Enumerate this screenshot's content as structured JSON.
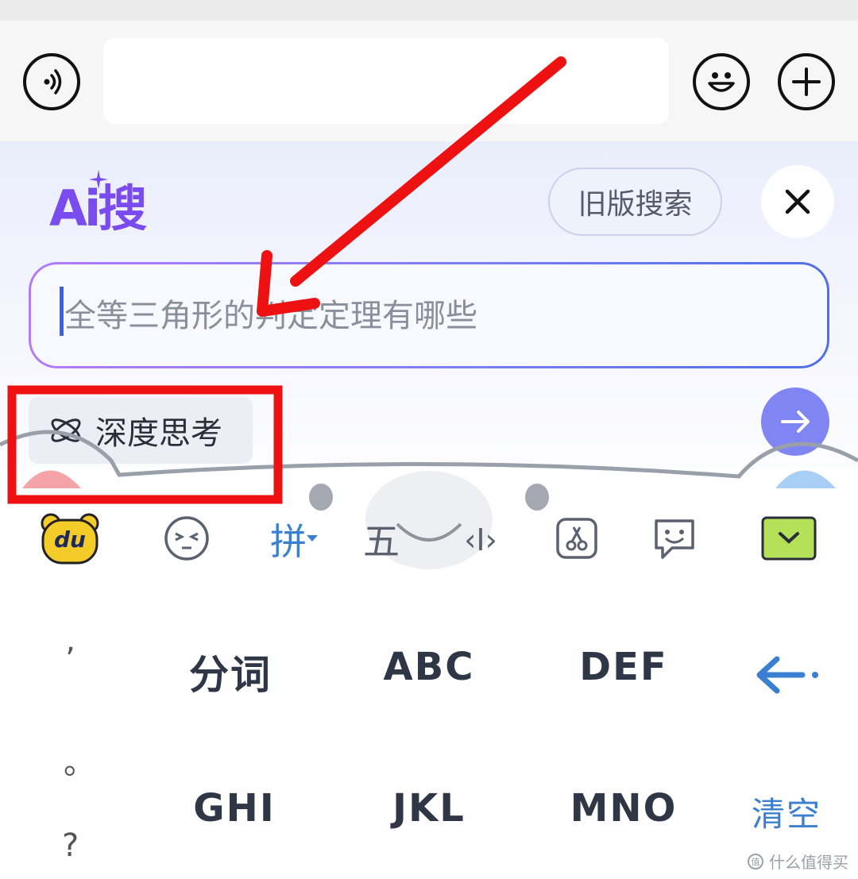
{
  "chat_bar": {
    "voice_icon": "voice-icon",
    "emoji_icon": "emoji-icon",
    "plus_icon": "plus-icon"
  },
  "ai_search": {
    "logo_text": "Ai搜",
    "old_search_label": "旧版搜索",
    "close_icon": "close-icon",
    "input_placeholder": "全等三角形的判定定理有哪些",
    "deep_think_label": "深度思考",
    "send_icon": "arrow-right-icon"
  },
  "keyboard": {
    "toolbar": {
      "logo_text": "du",
      "pinyin_label": "拼",
      "wubi_label": "五",
      "cursor_label": "‹I›"
    },
    "side_punct": [
      "’",
      "。",
      "?"
    ],
    "keys_row1": [
      "分词",
      "ABC",
      "DEF"
    ],
    "keys_row2": [
      "GHI",
      "JKL",
      "MNO"
    ],
    "clear_label": "清空"
  },
  "watermark": "什么值得买",
  "colors": {
    "accent_purple": "#7a4cf0",
    "annotation_red": "#ee1111",
    "keyboard_blue": "#3b7fd0"
  }
}
